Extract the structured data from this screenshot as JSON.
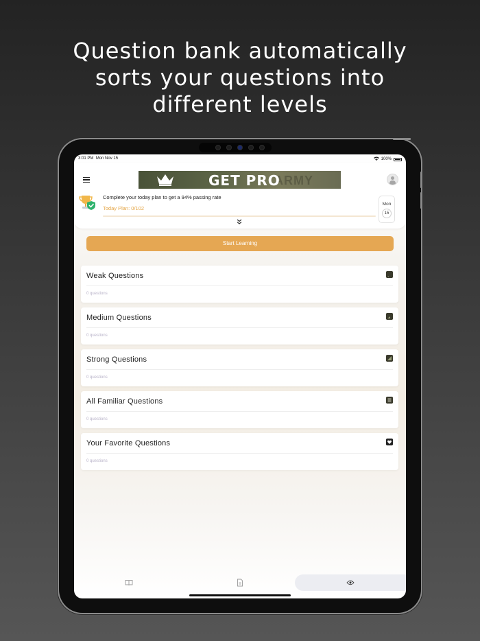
{
  "headline": {
    "lines": [
      "Question bank automatically",
      "sorts your questions into",
      "different levels"
    ]
  },
  "status_bar": {
    "time": "3:01 PM",
    "date": "Mon Nov 15",
    "wifi_icon": "wifi-icon",
    "battery": "100%"
  },
  "header": {
    "menu_icon": "hamburger-menu-icon",
    "banner": {
      "text": "GET PRO",
      "watermark": "ARMY",
      "icon": "crown-icon"
    },
    "profile_icon": "user-avatar-icon"
  },
  "plan": {
    "icon": "trophy-shield-icon",
    "message": "Complete your today plan to get a 94% passing rate",
    "progress_label": "Today Plan: 0/102",
    "progress_fraction": 0,
    "date": {
      "weekday": "Mon",
      "day": "15"
    },
    "expand_icon": "double-chevron-down-icon"
  },
  "start_button": {
    "label": "Start Learning",
    "color": "#e5a753"
  },
  "categories": [
    {
      "title": "Weak Questions",
      "count": "0 questions",
      "icon": "weak-signal-icon"
    },
    {
      "title": "Medium Questions",
      "count": "0 questions",
      "icon": "medium-signal-icon"
    },
    {
      "title": "Strong Questions",
      "count": "0 questions",
      "icon": "strong-signal-icon"
    },
    {
      "title": "All Familiar Questions",
      "count": "0 questions",
      "icon": "list-icon"
    },
    {
      "title": "Your Favorite Questions",
      "count": "0 questions",
      "icon": "heart-icon"
    }
  ],
  "tabbar": {
    "tabs": [
      {
        "icon": "book-icon",
        "active": false
      },
      {
        "icon": "document-icon",
        "active": false
      },
      {
        "icon": "eye-icon",
        "active": true
      }
    ]
  },
  "colors": {
    "accent": "#e5a753",
    "progress_label": "#e4a443",
    "icon_tint": "#3a3a2c"
  }
}
